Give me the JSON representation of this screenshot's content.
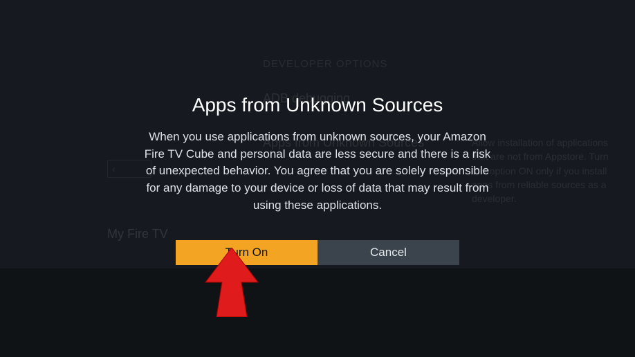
{
  "background": {
    "heading": "DEVELOPER OPTIONS",
    "adb_label": "ADB debugging",
    "aus_label": "Apps from Unknown Sources",
    "help_text": "Allow installation of applications that are not from Appstore. Turn this option ON only if you install apps from reliable sources as a developer.",
    "back_label": "‹",
    "section_label": "My Fire TV"
  },
  "dialog": {
    "title": "Apps from Unknown Sources",
    "body": "When you use applications from unknown sources, your Amazon Fire TV Cube and personal data are less secure and there is a risk of unexpected behavior. You agree that you are solely responsible for any damage to your device or loss of data that may result from using these applications.",
    "turn_on_label": "Turn On",
    "cancel_label": "Cancel"
  }
}
